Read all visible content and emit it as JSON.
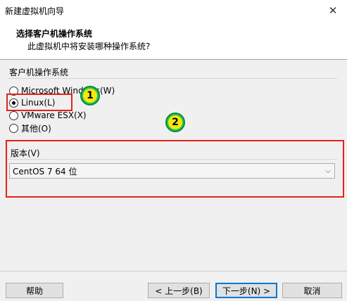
{
  "window": {
    "title": "新建虚拟机向导",
    "close_glyph": "✕"
  },
  "header": {
    "title": "选择客户机操作系统",
    "subtitle": "此虚拟机中将安装哪种操作系统?"
  },
  "os_group": {
    "label": "客户机操作系统",
    "options": [
      {
        "label": "Microsoft Windows(W)",
        "selected": false
      },
      {
        "label": "Linux(L)",
        "selected": true
      },
      {
        "label": "VMware ESX(X)",
        "selected": false
      },
      {
        "label": "其他(O)",
        "selected": false
      }
    ]
  },
  "version": {
    "label": "版本(V)",
    "value": "CentOS 7 64 位"
  },
  "annotations": {
    "badge1": "1",
    "badge2": "2",
    "highlight_color": "#e2231a",
    "badge_color": "#22c55e"
  },
  "buttons": {
    "help": "帮助",
    "back": "< 上一步(B)",
    "next": "下一步(N) >",
    "cancel": "取消"
  }
}
